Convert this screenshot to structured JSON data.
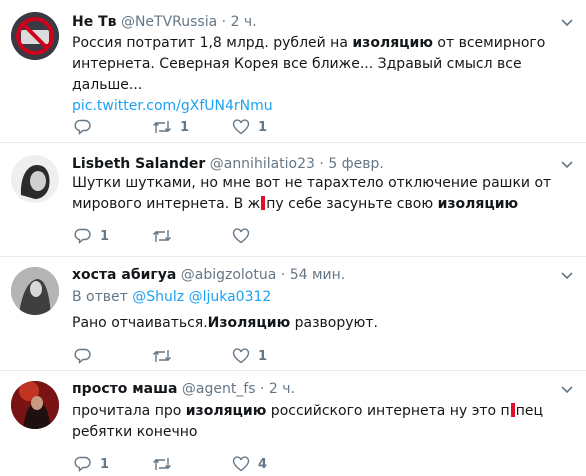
{
  "tweets": [
    {
      "name": "Не Тв",
      "handle": "@NeTVRussia",
      "time": "2 ч.",
      "text_before": "Россия потратит 1,8 млрд. рублей на ",
      "text_bold": "изоляцию",
      "text_after": " от всемирного интернета. Северная Корея все ближе... Здравый смысл все дальше...",
      "link": "pic.twitter.com/gXfUN4rNmu",
      "replies": "",
      "retweets": "1",
      "likes": "1"
    },
    {
      "name": "Lisbeth Salander",
      "handle": "@annihilatio23",
      "time": "5 февр.",
      "text_before": "Шутки шутками, но мне вот не тарахтело отключение рашки от мирового интернета. В ж",
      "text_mid": "пу себе засуньте свою ",
      "text_bold": "изоляцию",
      "replies": "1",
      "retweets": "",
      "likes": ""
    },
    {
      "name": "хоста абигуа",
      "handle": "@abigzolotua",
      "time": "54 мин.",
      "reply_prefix": "В ответ ",
      "reply_user1": "@Shulz",
      "reply_user2": "@ljuka0312",
      "text_before": "Рано отчаиваться.",
      "text_bold": "Изоляцию",
      "text_after": " разворуют.",
      "replies": "",
      "retweets": "",
      "likes": "1"
    },
    {
      "name": "просто маша",
      "handle": "@agent_fs",
      "time": "2 ч.",
      "text_before": "прочитала про ",
      "text_bold": "изоляцию",
      "text_mid": " российского интернета ну это п",
      "text_after": "пец ребятки конечно",
      "replies": "1",
      "retweets": "",
      "likes": "4"
    }
  ],
  "dot": "·",
  "colors": {
    "link": "#1da1f2",
    "muted": "#657786",
    "redaction": "#e0102a"
  }
}
